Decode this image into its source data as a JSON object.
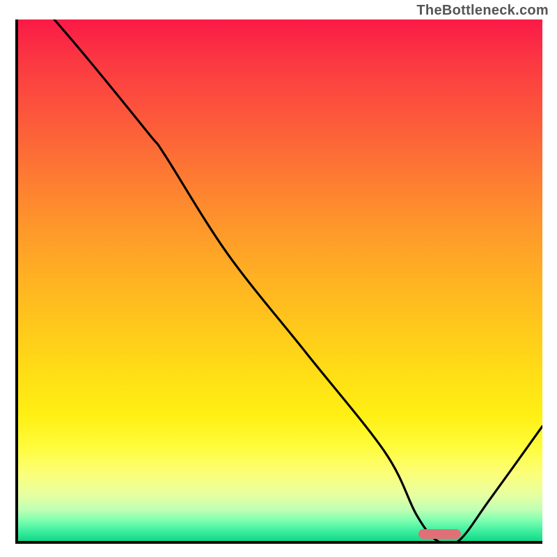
{
  "watermark": "TheBottleneck.com",
  "chart_data": {
    "type": "line",
    "title": "",
    "xlabel": "",
    "ylabel": "",
    "xlim": [
      0,
      100
    ],
    "ylim": [
      0,
      100
    ],
    "series": [
      {
        "name": "curve",
        "x": [
          0,
          12,
          25,
          28,
          40,
          55,
          70,
          76,
          80,
          84,
          90,
          100
        ],
        "values": [
          108,
          94,
          78,
          74,
          55,
          36,
          17,
          5,
          0,
          0,
          8,
          22
        ]
      }
    ],
    "marker": {
      "x_start": 76,
      "x_end": 84,
      "y": 1
    },
    "gradient_stops": [
      {
        "pct": 0,
        "color": "#fa1a46"
      },
      {
        "pct": 50,
        "color": "#ffc020"
      },
      {
        "pct": 82,
        "color": "#fffc3c"
      },
      {
        "pct": 100,
        "color": "#10d888"
      }
    ]
  }
}
